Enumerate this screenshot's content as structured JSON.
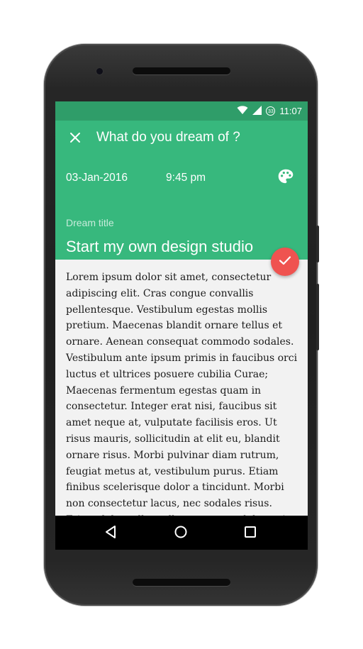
{
  "status_bar": {
    "time": "11:07",
    "battery_level": "33",
    "icons": [
      "wifi-icon",
      "signal-icon",
      "battery-icon"
    ]
  },
  "header": {
    "close_icon": "close-icon",
    "title": "What do you dream of ?",
    "date": "03-Jan-2016",
    "time": "9:45 pm",
    "palette_icon": "palette-icon",
    "dream_title_label": "Dream title",
    "dream_title_value": "Start my own design studio"
  },
  "fab": {
    "icon": "check-icon",
    "color": "#ef5350"
  },
  "body": {
    "text": "Lorem ipsum dolor sit amet, consectetur adipiscing elit. Cras congue convallis pellentesque. Vestibulum egestas mollis pretium. Maecenas blandit ornare tellus et ornare. Aenean consequat commodo sodales. Vestibulum ante ipsum primis in faucibus orci luctus et ultrices posuere cubilia Curae; Maecenas fermentum egestas quam in consectetur. Integer erat nisi, faucibus sit amet neque at, vulputate facilisis eros. Ut risus mauris, sollicitudin at elit eu, blandit ornare risus. Morbi pulvinar diam rutrum, feugiat metus at, vestibulum purus. Etiam finibus scelerisque dolor a tincidunt. Morbi non consectetur lacus, nec sodales risus. Etiam dolor tellus, ullamcorper ut dolor quis, aliquam molestie velit. Vivamus sagittis dignissim"
  },
  "nav_bar": {
    "buttons": [
      "back-icon",
      "home-icon",
      "recents-icon"
    ]
  },
  "colors": {
    "accent": "#37b87d",
    "status_bar": "#2f9d69",
    "fab": "#ef5350",
    "body_background": "#f2f2f2"
  }
}
